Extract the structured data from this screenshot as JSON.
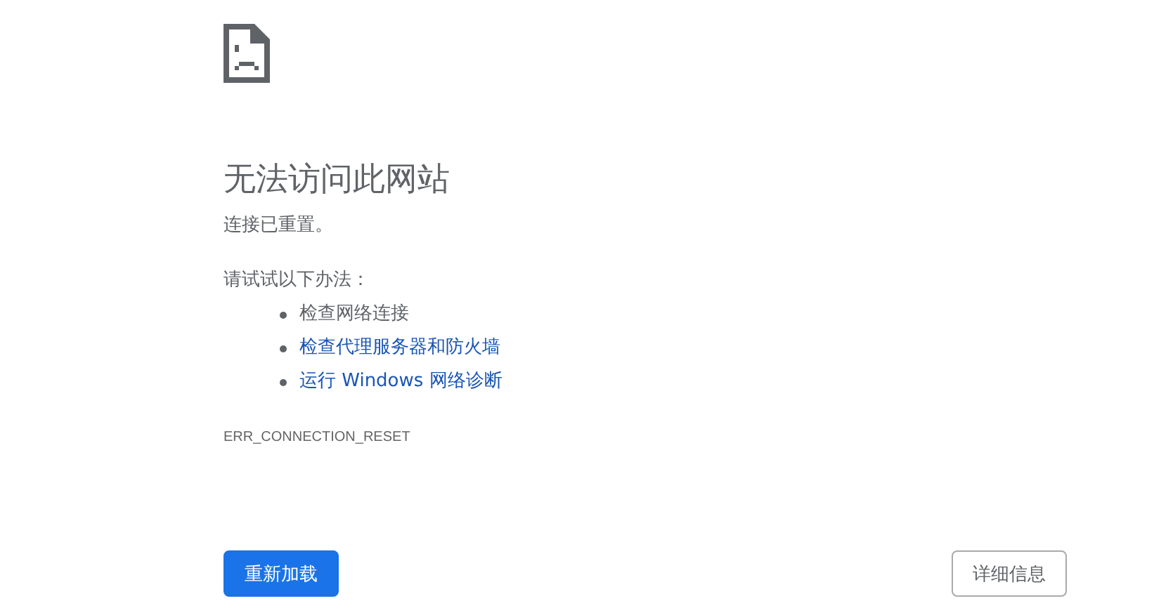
{
  "heading": "无法访问此网站",
  "message": "连接已重置。",
  "suggestions_intro": "请试试以下办法：",
  "suggestions": [
    {
      "kind": "text",
      "label": "检查网络连接"
    },
    {
      "kind": "link",
      "label": "检查代理服务器和防火墙"
    },
    {
      "kind": "link",
      "label": "运行 Windows 网络诊断"
    }
  ],
  "error_code": "ERR_CONNECTION_RESET",
  "buttons": [
    {
      "kind": "primary",
      "label": "重新加载"
    },
    {
      "kind": "secondary",
      "label": "详细信息"
    }
  ]
}
